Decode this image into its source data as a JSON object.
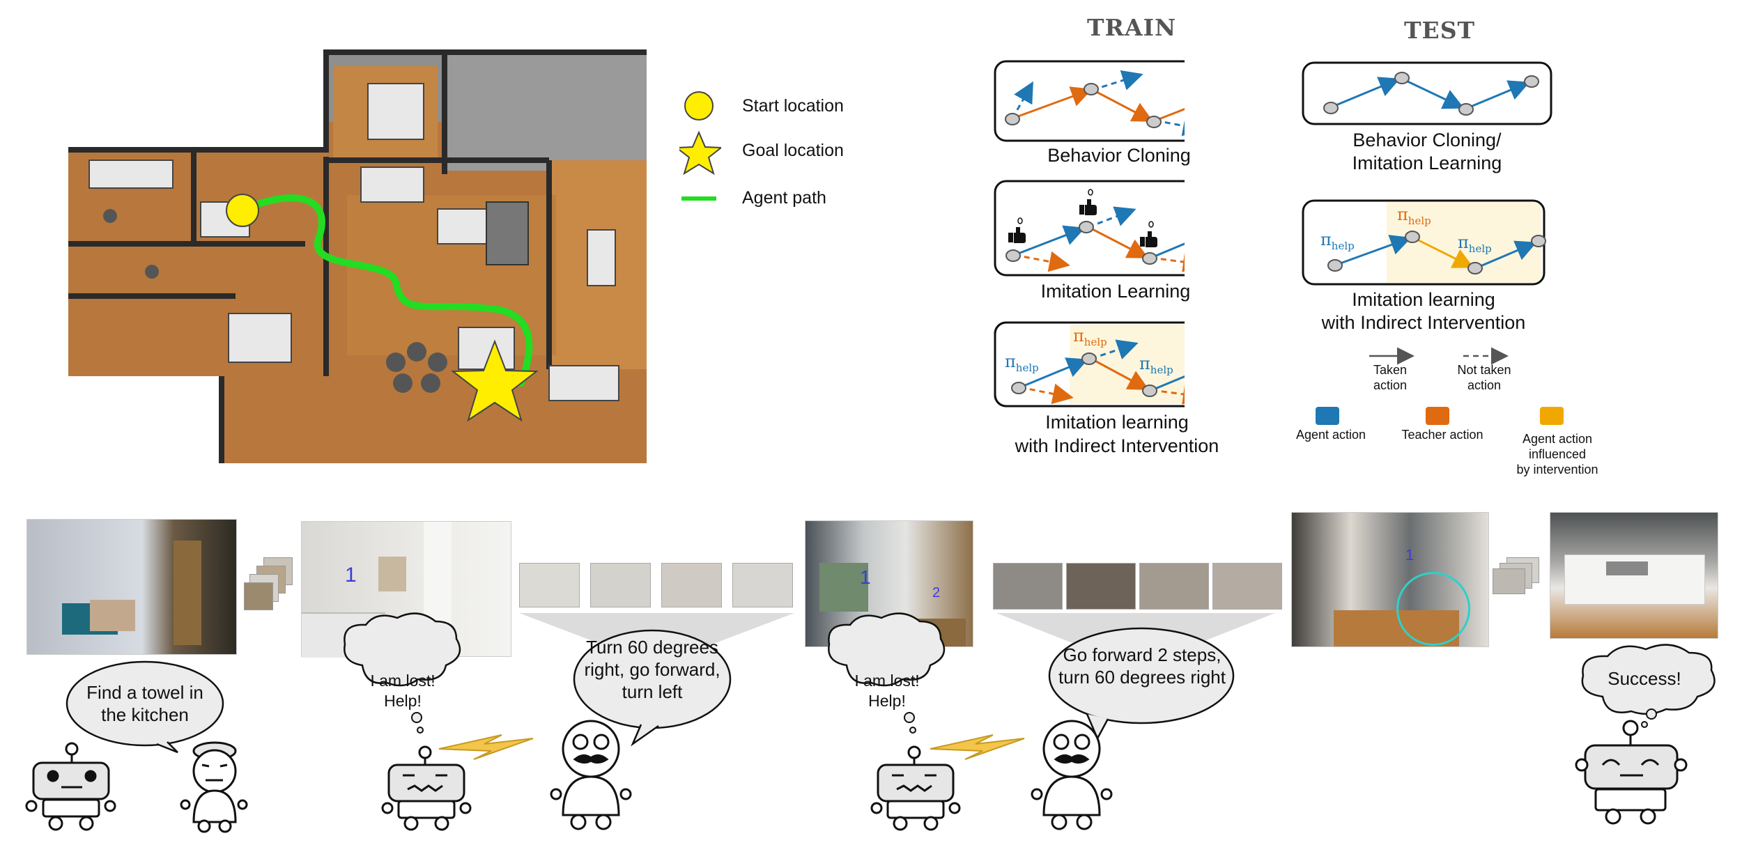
{
  "legend": {
    "start": "Start location",
    "goal": "Goal location",
    "path": "Agent path"
  },
  "train": {
    "title": "TRAIN",
    "bc_caption": "Behavior Cloning",
    "il_caption": "Imitation Learning",
    "iii_caption_1": "Imitation learning",
    "iii_caption_2": "with Indirect Intervention"
  },
  "test": {
    "title": "TEST",
    "bc_caption_1": "Behavior Cloning/",
    "bc_caption_2": "Imitation Learning",
    "iii_caption_1": "Imitation learning",
    "iii_caption_2": "with Indirect Intervention"
  },
  "pi_symbol": "π",
  "pi_subscript": "help",
  "action_legend": {
    "taken_1": "Taken",
    "taken_2": "action",
    "not_taken_1": "Not taken",
    "not_taken_2": "action",
    "agent": "Agent action",
    "teacher": "Teacher action",
    "influenced_1": "Agent action",
    "influenced_2": "influenced",
    "influenced_3": "by intervention"
  },
  "bubbles": {
    "task_1": "Find a towel in",
    "task_2": "the kitchen",
    "lost1_1": "I am lost!",
    "lost1_2": "Help!",
    "help1_1": "Turn 60 degrees",
    "help1_2": "right, go forward,",
    "help1_3": "turn left",
    "lost2_1": "I am lost!",
    "lost2_2": "Help!",
    "help2_1": "Go forward 2 steps,",
    "help2_2": "turn 60 degrees right",
    "success": "Success!"
  },
  "view_markers": {
    "v1": "1",
    "v2": "1",
    "v3": "2",
    "v4": "1"
  },
  "colors": {
    "agent_blue": "#1f77b4",
    "teacher_orange": "#e06a10",
    "influenced_yellow": "#f0a800",
    "path_green": "#22dd22",
    "start_yellow": "#ffee00",
    "highlight_bg": "#fdf6dc"
  }
}
